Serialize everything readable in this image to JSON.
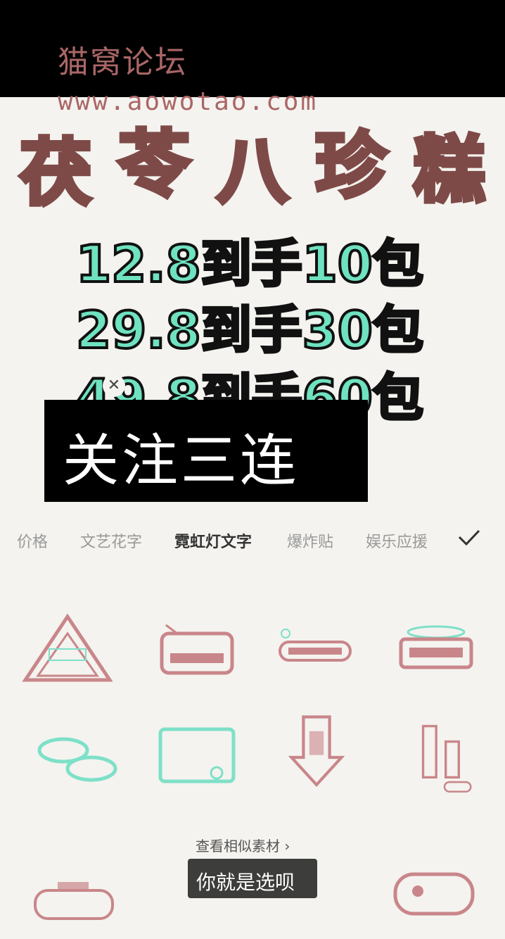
{
  "watermark": {
    "name": "猫窝论坛",
    "url": "www.aowotao.com"
  },
  "title_chars": [
    "茯",
    "苓",
    "八",
    "珍",
    "糕"
  ],
  "price_lines": [
    "12.8到手10包",
    "29.8到手30包",
    "49.8到手60包"
  ],
  "text_overlay": {
    "content": "关注三连",
    "close_symbol": "✕"
  },
  "tabs": [
    {
      "label": "价格"
    },
    {
      "label": "文艺花字"
    },
    {
      "label": "霓虹灯文字"
    },
    {
      "label": "爆炸贴"
    },
    {
      "label": "娱乐应援"
    }
  ],
  "active_tab": "霓虹灯文字",
  "similar_link": "查看相似素材 ›",
  "subtitle": "你就是选呗",
  "colors": {
    "title_fill": "#b99a94",
    "title_stroke": "#7e4a48",
    "price_fill": "#6fe2c0",
    "sticker_pink": "#c9868a",
    "sticker_teal": "#7ee0c8"
  }
}
